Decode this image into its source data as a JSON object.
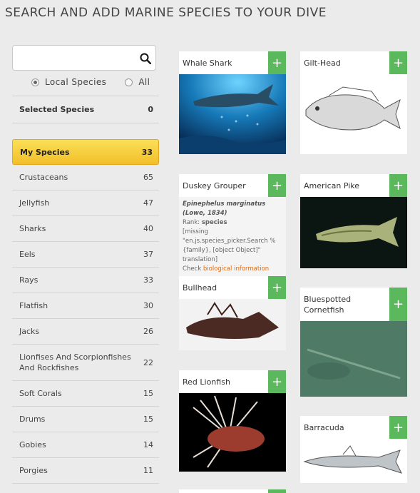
{
  "header": {
    "title": "SEARCH AND ADD MARINE SPECIES TO YOUR DIVE"
  },
  "search": {
    "placeholder": "",
    "value": ""
  },
  "filters": {
    "local_label": "Local Species",
    "all_label": "All",
    "selected": "local"
  },
  "selected_species": {
    "label": "Selected Species",
    "count": "0"
  },
  "categories": [
    {
      "name": "My Species",
      "count": "33",
      "active": true
    },
    {
      "name": "Crustaceans",
      "count": "65"
    },
    {
      "name": "Jellyfish",
      "count": "47"
    },
    {
      "name": "Sharks",
      "count": "40"
    },
    {
      "name": "Eels",
      "count": "37"
    },
    {
      "name": "Rays",
      "count": "33"
    },
    {
      "name": "Flatfish",
      "count": "30"
    },
    {
      "name": "Jacks",
      "count": "26"
    },
    {
      "name": "Lionfises And Scorpionfishes And Rockfishes",
      "count": "22"
    },
    {
      "name": "Soft Corals",
      "count": "15"
    },
    {
      "name": "Drums",
      "count": "15"
    },
    {
      "name": "Gobies",
      "count": "14"
    },
    {
      "name": "Porgies",
      "count": "11"
    }
  ],
  "add_label": "+",
  "species": {
    "whale_shark": {
      "name": "Whale Shark"
    },
    "gilt_head": {
      "name": "Gilt-Head"
    },
    "duskey_grouper": {
      "name": "Duskey Grouper",
      "scientific": "Epinephelus marginatus (Lowe, 1834)",
      "rank_label": "Rank:",
      "rank": "species",
      "missing": "[missing \"en.js.species_picker.Search % {family}, [object Object]\" translation]",
      "check_label": "Check",
      "check_link": "biological information"
    },
    "american_pike": {
      "name": "American Pike"
    },
    "bullhead": {
      "name": "Bullhead"
    },
    "bluespotted_cornetfish": {
      "name": "Bluespotted Cornetfish"
    },
    "red_lionfish": {
      "name": "Red Lionfish"
    },
    "barracuda": {
      "name": "Barracuda"
    }
  },
  "colors": {
    "accent_green": "#5cb85c",
    "active_yellow": "#f2bf2a",
    "link_orange": "#e36a12"
  }
}
